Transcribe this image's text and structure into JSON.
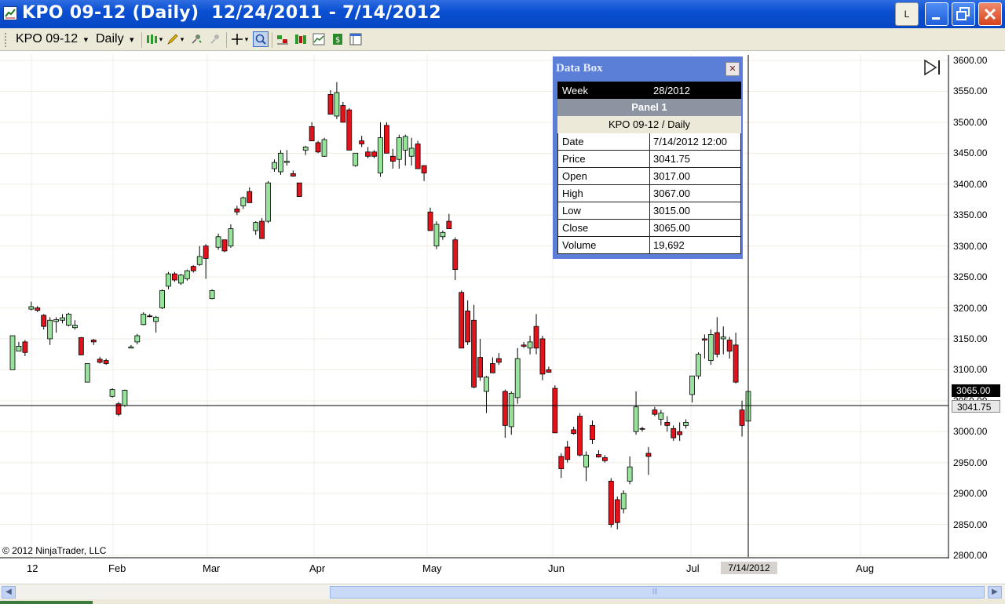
{
  "window": {
    "title": "KPO 09-12 (Daily)  12/24/2011 - 7/14/2012",
    "buttons": {
      "log": "L",
      "minimize": "_",
      "maximize": "□",
      "close": "✕"
    }
  },
  "toolbar": {
    "instrument": "KPO 09-12",
    "interval": "Daily",
    "dropdown_glyph": "▾",
    "tools": [
      "bar-type-icon",
      "draw-icon",
      "pin-icon",
      "pin-disabled-icon",
      "crosshair-icon",
      "zoom-icon",
      "indicators-icon",
      "strategies-icon",
      "chart-properties-icon",
      "money-icon",
      "layout-icon"
    ]
  },
  "chart": {
    "copyright": "© 2012 NinjaTrader, LLC",
    "x_tick_labels": [
      "12",
      "Feb",
      "Mar",
      "Apr",
      "May",
      "Jun",
      "Jul",
      "Aug"
    ],
    "y_tick_labels": [
      "3600.00",
      "3550.00",
      "3500.00",
      "3450.00",
      "3400.00",
      "3350.00",
      "3300.00",
      "3250.00",
      "3200.00",
      "3150.00",
      "3100.00",
      "3050.00",
      "3000.00",
      "2950.00",
      "2900.00",
      "2850.00",
      "2800.00"
    ],
    "cursor_date": "7/14/2012",
    "last_close_label": "3065.00",
    "cursor_price_label": "3041.75",
    "colors": {
      "up": "#98e39c",
      "down": "#e3121b",
      "grid": "#f1eee2"
    }
  },
  "chart_data": {
    "type": "candlestick",
    "ylim": [
      2800,
      3600
    ],
    "x_labels": [
      "12",
      "Feb",
      "Mar",
      "Apr",
      "May",
      "Jun",
      "Jul",
      "Aug"
    ],
    "cursor": {
      "date": "7/14/2012",
      "price": 3041.75
    },
    "last_close": 3065.0,
    "candles": [
      {
        "o": 3100,
        "h": 3155,
        "l": 3100,
        "c": 3155
      },
      {
        "o": 3130,
        "h": 3145,
        "l": 3130,
        "c": 3138
      },
      {
        "o": 3145,
        "h": 3148,
        "l": 3122,
        "c": 3128
      },
      {
        "o": 3198,
        "h": 3210,
        "l": 3196,
        "c": 3202
      },
      {
        "o": 3200,
        "h": 3203,
        "l": 3193,
        "c": 3196
      },
      {
        "o": 3188,
        "h": 3190,
        "l": 3165,
        "c": 3170
      },
      {
        "o": 3150,
        "h": 3185,
        "l": 3140,
        "c": 3180
      },
      {
        "o": 3178,
        "h": 3185,
        "l": 3160,
        "c": 3181
      },
      {
        "o": 3180,
        "h": 3190,
        "l": 3175,
        "c": 3184
      },
      {
        "o": 3172,
        "h": 3192,
        "l": 3170,
        "c": 3190
      },
      {
        "o": 3168,
        "h": 3180,
        "l": 3165,
        "c": 3172
      },
      {
        "o": 3152,
        "h": 3153,
        "l": 3125,
        "c": 3124
      },
      {
        "o": 3080,
        "h": 3110,
        "l": 3080,
        "c": 3110
      },
      {
        "o": 3148,
        "h": 3150,
        "l": 3140,
        "c": 3145
      },
      {
        "o": 3117,
        "h": 3121,
        "l": 3110,
        "c": 3112
      },
      {
        "o": 3115,
        "h": 3118,
        "l": 3108,
        "c": 3110
      },
      {
        "o": 3057,
        "h": 3070,
        "l": 3055,
        "c": 3068
      },
      {
        "o": 3045,
        "h": 3048,
        "l": 3025,
        "c": 3028
      },
      {
        "o": 3042,
        "h": 3068,
        "l": 3040,
        "c": 3067
      },
      {
        "o": 3135,
        "h": 3140,
        "l": 3135,
        "c": 3137
      },
      {
        "o": 3145,
        "h": 3158,
        "l": 3141,
        "c": 3155
      },
      {
        "o": 3173,
        "h": 3193,
        "l": 3172,
        "c": 3190
      },
      {
        "o": 3187,
        "h": 3190,
        "l": 3185,
        "c": 3186
      },
      {
        "o": 3178,
        "h": 3187,
        "l": 3160,
        "c": 3185
      },
      {
        "o": 3200,
        "h": 3230,
        "l": 3198,
        "c": 3228
      },
      {
        "o": 3235,
        "h": 3258,
        "l": 3230,
        "c": 3255
      },
      {
        "o": 3255,
        "h": 3258,
        "l": 3242,
        "c": 3245
      },
      {
        "o": 3240,
        "h": 3255,
        "l": 3237,
        "c": 3253
      },
      {
        "o": 3247,
        "h": 3262,
        "l": 3244,
        "c": 3260
      },
      {
        "o": 3267,
        "h": 3269,
        "l": 3257,
        "c": 3260
      },
      {
        "o": 3270,
        "h": 3300,
        "l": 3268,
        "c": 3283
      },
      {
        "o": 3300,
        "h": 3303,
        "l": 3247,
        "c": 3280
      },
      {
        "o": 3215,
        "h": 3230,
        "l": 3214,
        "c": 3228
      },
      {
        "o": 3298,
        "h": 3320,
        "l": 3294,
        "c": 3315
      },
      {
        "o": 3310,
        "h": 3310,
        "l": 3290,
        "c": 3292
      },
      {
        "o": 3300,
        "h": 3335,
        "l": 3297,
        "c": 3328
      },
      {
        "o": 3360,
        "h": 3365,
        "l": 3350,
        "c": 3355
      },
      {
        "o": 3365,
        "h": 3380,
        "l": 3360,
        "c": 3378
      },
      {
        "o": 3388,
        "h": 3395,
        "l": 3370,
        "c": 3370
      },
      {
        "o": 3325,
        "h": 3340,
        "l": 3318,
        "c": 3338
      },
      {
        "o": 3340,
        "h": 3345,
        "l": 3312,
        "c": 3312
      },
      {
        "o": 3340,
        "h": 3405,
        "l": 3337,
        "c": 3402
      },
      {
        "o": 3425,
        "h": 3440,
        "l": 3420,
        "c": 3435
      },
      {
        "o": 3420,
        "h": 3455,
        "l": 3415,
        "c": 3450
      },
      {
        "o": 3435,
        "h": 3455,
        "l": 3430,
        "c": 3437
      },
      {
        "o": 3417,
        "h": 3422,
        "l": 3412,
        "c": 3413
      },
      {
        "o": 3402,
        "h": 3402,
        "l": 3380,
        "c": 3380
      },
      {
        "o": 3455,
        "h": 3462,
        "l": 3447,
        "c": 3460
      },
      {
        "o": 3493,
        "h": 3500,
        "l": 3470,
        "c": 3470
      },
      {
        "o": 3467,
        "h": 3470,
        "l": 3450,
        "c": 3452
      },
      {
        "o": 3445,
        "h": 3475,
        "l": 3444,
        "c": 3472
      },
      {
        "o": 3545,
        "h": 3552,
        "l": 3513,
        "c": 3513
      },
      {
        "o": 3510,
        "h": 3565,
        "l": 3505,
        "c": 3548
      },
      {
        "o": 3527,
        "h": 3533,
        "l": 3500,
        "c": 3500
      },
      {
        "o": 3520,
        "h": 3523,
        "l": 3455,
        "c": 3455
      },
      {
        "o": 3430,
        "h": 3450,
        "l": 3428,
        "c": 3450
      },
      {
        "o": 3470,
        "h": 3478,
        "l": 3460,
        "c": 3465
      },
      {
        "o": 3452,
        "h": 3460,
        "l": 3442,
        "c": 3445
      },
      {
        "o": 3452,
        "h": 3455,
        "l": 3442,
        "c": 3445
      },
      {
        "o": 3418,
        "h": 3500,
        "l": 3412,
        "c": 3475
      },
      {
        "o": 3495,
        "h": 3500,
        "l": 3450,
        "c": 3450
      },
      {
        "o": 3445,
        "h": 3457,
        "l": 3425,
        "c": 3437
      },
      {
        "o": 3440,
        "h": 3480,
        "l": 3425,
        "c": 3475
      },
      {
        "o": 3455,
        "h": 3480,
        "l": 3430,
        "c": 3477
      },
      {
        "o": 3445,
        "h": 3475,
        "l": 3430,
        "c": 3458
      },
      {
        "o": 3465,
        "h": 3470,
        "l": 3430,
        "c": 3425
      },
      {
        "o": 3430,
        "h": 3430,
        "l": 3405,
        "c": 3418
      },
      {
        "o": 3355,
        "h": 3362,
        "l": 3325,
        "c": 3325
      },
      {
        "o": 3300,
        "h": 3340,
        "l": 3295,
        "c": 3335
      },
      {
        "o": 3315,
        "h": 3325,
        "l": 3310,
        "c": 3322
      },
      {
        "o": 3340,
        "h": 3352,
        "l": 3328,
        "c": 3328
      },
      {
        "o": 3310,
        "h": 3314,
        "l": 3245,
        "c": 3262
      },
      {
        "o": 3225,
        "h": 3228,
        "l": 3135,
        "c": 3135
      },
      {
        "o": 3195,
        "h": 3212,
        "l": 3140,
        "c": 3145
      },
      {
        "o": 3180,
        "h": 3205,
        "l": 3070,
        "c": 3072
      },
      {
        "o": 3120,
        "h": 3150,
        "l": 3082,
        "c": 3088
      },
      {
        "o": 3065,
        "h": 3090,
        "l": 3030,
        "c": 3088
      },
      {
        "o": 3110,
        "h": 3120,
        "l": 3105,
        "c": 3095
      },
      {
        "o": 3118,
        "h": 3127,
        "l": 3108,
        "c": 3112
      },
      {
        "o": 3065,
        "h": 3068,
        "l": 2990,
        "c": 3010
      },
      {
        "o": 3008,
        "h": 3065,
        "l": 2995,
        "c": 3062
      },
      {
        "o": 3055,
        "h": 3135,
        "l": 3045,
        "c": 3118
      },
      {
        "o": 3140,
        "h": 3145,
        "l": 3135,
        "c": 3138
      },
      {
        "o": 3135,
        "h": 3155,
        "l": 3125,
        "c": 3145
      },
      {
        "o": 3170,
        "h": 3190,
        "l": 3125,
        "c": 3135
      },
      {
        "o": 3150,
        "h": 3155,
        "l": 3083,
        "c": 3093
      },
      {
        "o": 3100,
        "h": 3105,
        "l": 3095,
        "c": 3096
      },
      {
        "o": 3070,
        "h": 3075,
        "l": 2998,
        "c": 2998
      },
      {
        "o": 2960,
        "h": 2965,
        "l": 2925,
        "c": 2940
      },
      {
        "o": 2975,
        "h": 2985,
        "l": 2950,
        "c": 2955
      },
      {
        "o": 3003,
        "h": 3008,
        "l": 2995,
        "c": 2997
      },
      {
        "o": 3025,
        "h": 3030,
        "l": 2960,
        "c": 2962
      },
      {
        "o": 2943,
        "h": 2968,
        "l": 2920,
        "c": 2962
      },
      {
        "o": 3010,
        "h": 3018,
        "l": 2980,
        "c": 2987
      },
      {
        "o": 2963,
        "h": 2970,
        "l": 2958,
        "c": 2959
      },
      {
        "o": 2958,
        "h": 2962,
        "l": 2950,
        "c": 2953
      },
      {
        "o": 2920,
        "h": 2925,
        "l": 2845,
        "c": 2850
      },
      {
        "o": 2890,
        "h": 2895,
        "l": 2842,
        "c": 2853
      },
      {
        "o": 2875,
        "h": 2905,
        "l": 2868,
        "c": 2900
      },
      {
        "o": 2920,
        "h": 2960,
        "l": 2915,
        "c": 2943
      },
      {
        "o": 3000,
        "h": 3065,
        "l": 2995,
        "c": 3040
      },
      {
        "o": 3005,
        "h": 3008,
        "l": 3000,
        "c": 3004
      },
      {
        "o": 2965,
        "h": 2975,
        "l": 2930,
        "c": 2960
      },
      {
        "o": 3035,
        "h": 3040,
        "l": 3025,
        "c": 3028
      },
      {
        "o": 3020,
        "h": 3035,
        "l": 3010,
        "c": 3030
      },
      {
        "o": 3015,
        "h": 3025,
        "l": 3000,
        "c": 3010
      },
      {
        "o": 3005,
        "h": 3010,
        "l": 2985,
        "c": 2990
      },
      {
        "o": 3000,
        "h": 3015,
        "l": 2985,
        "c": 2995
      },
      {
        "o": 3010,
        "h": 3020,
        "l": 3005,
        "c": 3015
      },
      {
        "o": 3060,
        "h": 3090,
        "l": 3047,
        "c": 3090
      },
      {
        "o": 3090,
        "h": 3128,
        "l": 3085,
        "c": 3125
      },
      {
        "o": 3150,
        "h": 3157,
        "l": 3118,
        "c": 3148
      },
      {
        "o": 3115,
        "h": 3165,
        "l": 3108,
        "c": 3157
      },
      {
        "o": 3160,
        "h": 3185,
        "l": 3120,
        "c": 3125
      },
      {
        "o": 3150,
        "h": 3170,
        "l": 3125,
        "c": 3153
      },
      {
        "o": 3148,
        "h": 3153,
        "l": 3118,
        "c": 3130
      },
      {
        "o": 3140,
        "h": 3160,
        "l": 3078,
        "c": 3080
      },
      {
        "o": 3035,
        "h": 3050,
        "l": 2992,
        "c": 3010
      },
      {
        "o": 3017,
        "h": 3067,
        "l": 3015,
        "c": 3065
      }
    ]
  },
  "databox": {
    "title": "Data Box",
    "close": "✕",
    "week_label": "Week",
    "week_value": "28/2012",
    "panel": "Panel 1",
    "instrument": "KPO 09-12 / Daily",
    "rows": [
      {
        "label": "Date",
        "value": "7/14/2012 12:00"
      },
      {
        "label": "Price",
        "value": "3041.75"
      },
      {
        "label": "Open",
        "value": "3017.00"
      },
      {
        "label": "High",
        "value": "3067.00"
      },
      {
        "label": "Low",
        "value": "3015.00"
      },
      {
        "label": "Close",
        "value": "3065.00"
      },
      {
        "label": "Volume",
        "value": "19,692"
      }
    ]
  },
  "scrollbar": {
    "left_arrow": "◀",
    "right_arrow": "▶",
    "grip": "|||"
  }
}
